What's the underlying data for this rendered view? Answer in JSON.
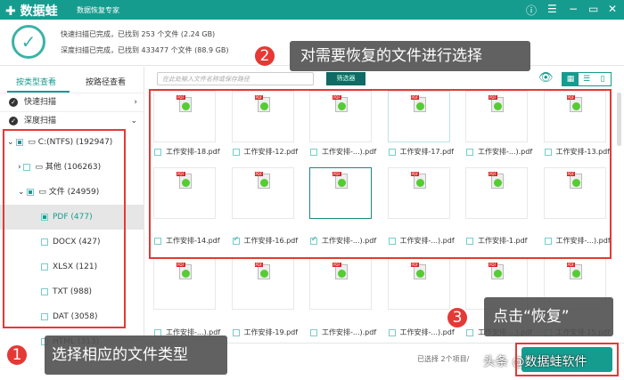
{
  "app": {
    "name": "数据蛙",
    "subtitle": "数据恢复专家"
  },
  "summary": {
    "quick": "快速扫描已完成，已找到 253 个文件 (2.24 GB)",
    "deep": "深度扫描已完成，已找到 433477 个文件 (88.9 GB)"
  },
  "tabs": [
    "按类型查看",
    "按路径查看"
  ],
  "scans": [
    "快速扫描",
    "深度扫描"
  ],
  "tree": [
    {
      "label": "C:(NTFS) (192947)",
      "state": "on"
    },
    {
      "label": "其他 (106263)",
      "state": "off"
    },
    {
      "label": "文件 (24959)",
      "state": "on"
    },
    {
      "label": "PDF (477)",
      "state": "on"
    },
    {
      "label": "DOCX (427)",
      "state": "off"
    },
    {
      "label": "XLSX (121)",
      "state": "off"
    },
    {
      "label": "TXT (988)",
      "state": "off"
    },
    {
      "label": "DAT (3058)",
      "state": "off"
    },
    {
      "label": "HTML (313)",
      "state": "off"
    }
  ],
  "search": {
    "placeholder": "在此处输入文件名称或保存路径"
  },
  "filter_label": "筛选器",
  "files": [
    {
      "name": "工作安排-18.pdf",
      "checked": false
    },
    {
      "name": "工作安排-12.pdf",
      "checked": false
    },
    {
      "name": "工作安排-...).pdf",
      "checked": false
    },
    {
      "name": "工作安排-17.pdf",
      "checked": false
    },
    {
      "name": "工作安排-...).pdf",
      "checked": false
    },
    {
      "name": "工作安排-13.pdf",
      "checked": false
    },
    {
      "name": "工作安排-14.pdf",
      "checked": false
    },
    {
      "name": "工作安排-16.pdf",
      "checked": true
    },
    {
      "name": "工作安排-...).pdf",
      "checked": true,
      "selected": true
    },
    {
      "name": "工作安排-...).pdf",
      "checked": false
    },
    {
      "name": "工作安排-1.pdf",
      "checked": false
    },
    {
      "name": "工作安排-...).pdf",
      "checked": false
    },
    {
      "name": "工作安排-...).pdf",
      "checked": false
    },
    {
      "name": "工作安排-19.pdf",
      "checked": false
    },
    {
      "name": "工作安排-...).pdf",
      "checked": false
    },
    {
      "name": "工作安排-...).pdf",
      "checked": false
    },
    {
      "name": "工作安排-...).pdf",
      "checked": false
    },
    {
      "name": "工作安排-15.pdf",
      "checked": false
    }
  ],
  "status": "已选择 2个项目/",
  "callouts": {
    "c1": {
      "num": "1",
      "text": "选择相应的文件类型"
    },
    "c2": {
      "num": "2",
      "text": "对需要恢复的文件进行选择"
    },
    "c3": {
      "num": "3",
      "text": "点击“恢复”"
    }
  },
  "watermark": "头条 @数据蛙软件",
  "colors": {
    "accent": "#169c8f",
    "annotation": "#e53935"
  }
}
